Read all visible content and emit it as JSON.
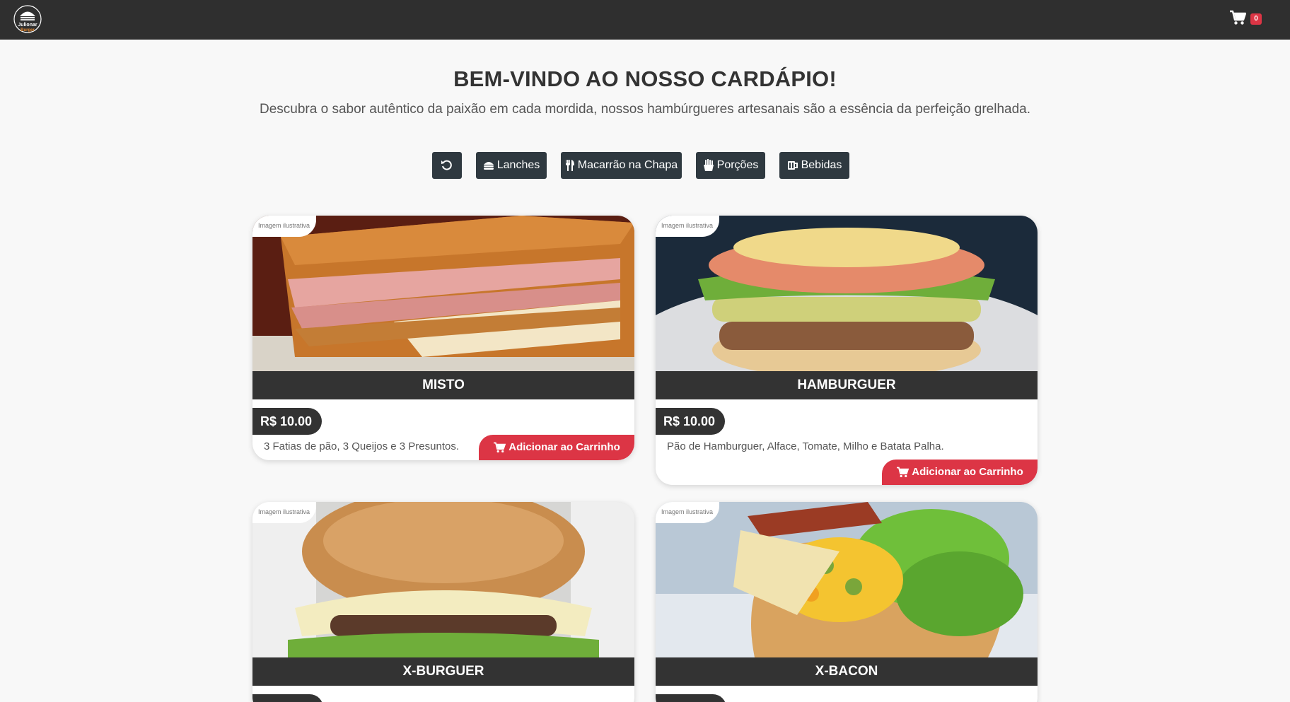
{
  "header": {
    "logo_text_1": "Julionar",
    "logo_text_2": "Burger",
    "cart_count": "0",
    "colors": {
      "bar": "#2f2f2f",
      "badge": "#dc3545"
    }
  },
  "hero": {
    "title": "BEM-VINDO AO NOSSO CARDÁPIO!",
    "subtitle": "Descubra o sabor autêntico da paixão em cada mordida, nossos hambúrgueres artesanais são a essência da perfeição grelhada."
  },
  "filters": [
    {
      "label": "",
      "icon": "reset-icon"
    },
    {
      "label": "Lanches",
      "icon": "burger-icon"
    },
    {
      "label": "Macarrão na Chapa",
      "icon": "utensils-icon"
    },
    {
      "label": "Porções",
      "icon": "fries-icon"
    },
    {
      "label": "Bebidas",
      "icon": "mug-icon"
    }
  ],
  "products": [
    {
      "name": "MISTO",
      "price": "R$ 10.00",
      "description": "3 Fatias de pão, 3 Queijos e 3 Presuntos.",
      "tag": "Imagem ilustrativa",
      "button": "Adicionar ao Carrinho"
    },
    {
      "name": "HAMBURGUER",
      "price": "R$ 10.00",
      "description": "Pão de Hamburguer, Alface, Tomate, Milho e Batata Palha.",
      "tag": "Imagem ilustrativa",
      "button": "Adicionar ao Carrinho"
    },
    {
      "name": "X-BURGUER",
      "price": "",
      "description": "",
      "tag": "Imagem ilustrativa",
      "button": ""
    },
    {
      "name": "X-BACON",
      "price": "",
      "description": "",
      "tag": "Imagem ilustrativa",
      "button": ""
    }
  ],
  "accent_color": "#dc3545"
}
